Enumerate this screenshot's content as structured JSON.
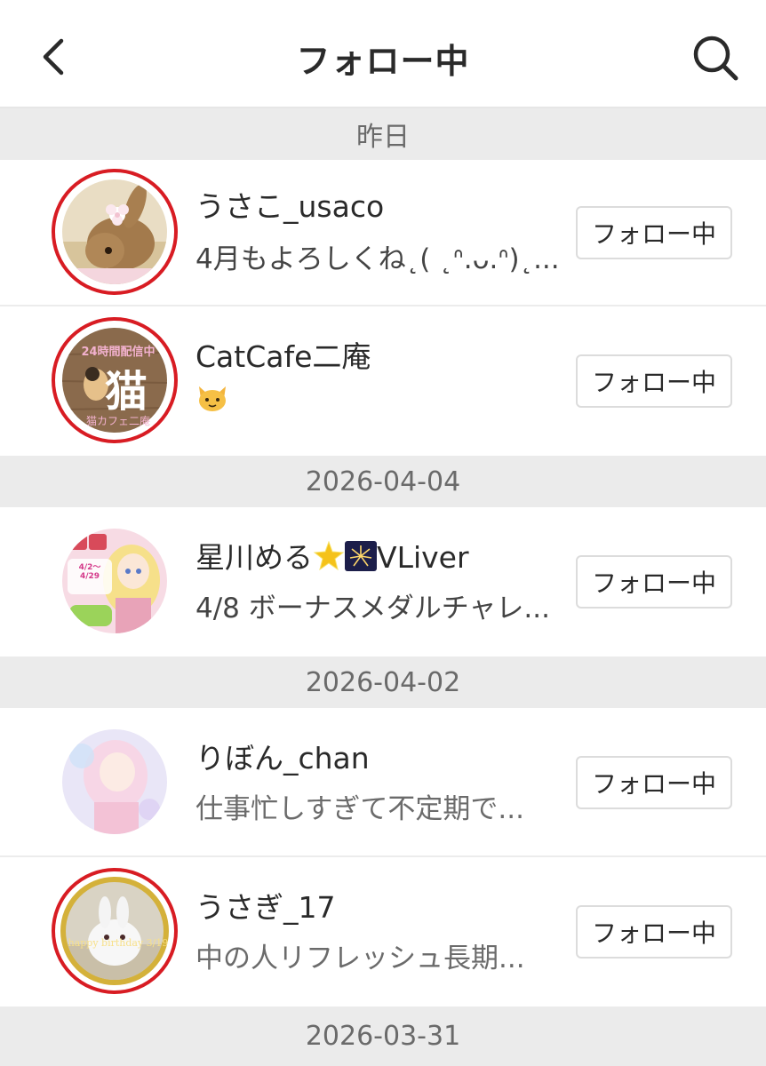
{
  "header": {
    "title": "フォロー中",
    "back_icon": "chevron-left-icon",
    "search_icon": "search-icon"
  },
  "sections": [
    {
      "date": "昨日"
    },
    {
      "date": "2026-04-04"
    },
    {
      "date": "2026-04-02"
    },
    {
      "date": "2026-03-31"
    }
  ],
  "users": [
    {
      "name": "うさこ_usaco",
      "message": "4月もよろしくね˛( ˛ᐢ.ᴗ.ᐢ)˛...",
      "button": "フォロー中",
      "ring": true
    },
    {
      "name": "CatCafe二庵",
      "message": "",
      "button": "フォロー中",
      "ring": true
    },
    {
      "name": "星川める",
      "name_suffix": "VLiver",
      "message": "4/8 ボーナスメダルチャレ...",
      "button": "フォロー中",
      "ring": false
    },
    {
      "name": "りぼん_chan",
      "message": "仕事忙しすぎて不定期で...",
      "button": "フォロー中",
      "ring": false
    },
    {
      "name": "うさぎ_17",
      "message": "中の人リフレッシュ長期...",
      "button": "フォロー中",
      "ring": true
    }
  ],
  "avatar_text": {
    "catcafe_top": "24時間配信中",
    "catcafe_kanji": "猫",
    "catcafe_bottom": "猫カフェ二庵",
    "usagi17_caption": "happy birthday 3/19",
    "vliver_date": "4/2〜4/29"
  },
  "colors": {
    "ring": "#d81c23",
    "separator_bg": "#ebebeb",
    "accent_gold": "#d4b13a"
  }
}
